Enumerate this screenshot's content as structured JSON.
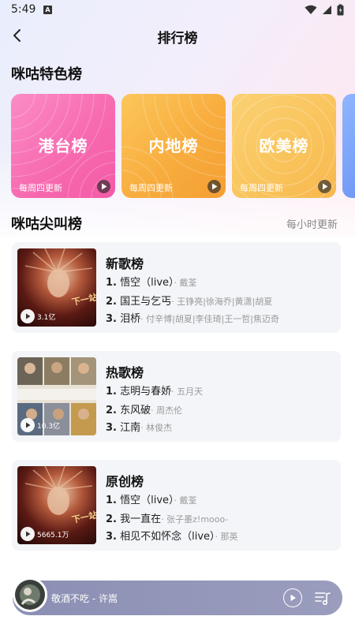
{
  "status": {
    "time": "5:49"
  },
  "header": {
    "title": "排行榜"
  },
  "featured": {
    "title": "咪咕特色榜",
    "cards": [
      {
        "name": "港台榜",
        "subtitle": "每周四更新",
        "color": "#f777b5"
      },
      {
        "name": "内地榜",
        "subtitle": "每周四更新",
        "color": "#f9b040"
      },
      {
        "name": "欧美榜",
        "subtitle": "每周四更新",
        "color": "#f9c75a"
      }
    ]
  },
  "ranks": {
    "title": "咪咕尖叫榜",
    "update_note": "每小时更新",
    "lists": [
      {
        "title": "新歌榜",
        "play_count": "3.1亿",
        "songs": [
          {
            "index": "1.",
            "name": "悟空（live）",
            "artist": "· 戴荃"
          },
          {
            "index": "2.",
            "name": "国王与乞丐",
            "artist": "· 王铮亮|徐海乔|黄潇|胡夏"
          },
          {
            "index": "3.",
            "name": "泪桥",
            "artist": "· 付辛博|胡夏|李佳琦|王一哲|焦迈奇"
          }
        ]
      },
      {
        "title": "热歌榜",
        "play_count": "10.3亿",
        "songs": [
          {
            "index": "1.",
            "name": "志明与春娇",
            "artist": "· 五月天"
          },
          {
            "index": "2.",
            "name": "东风破",
            "artist": "· 周杰伦"
          },
          {
            "index": "3.",
            "name": "江南",
            "artist": "· 林俊杰"
          }
        ]
      },
      {
        "title": "原创榜",
        "play_count": "5665.1万",
        "songs": [
          {
            "index": "1.",
            "name": "悟空（live）",
            "artist": "· 戴荃"
          },
          {
            "index": "2.",
            "name": "我一直在",
            "artist": "· 张子墨z!mooo-"
          },
          {
            "index": "3.",
            "name": "相见不如怀念（live）",
            "artist": "· 那英"
          }
        ]
      }
    ]
  },
  "player": {
    "song": "敬酒不吃 - 许嵩"
  }
}
